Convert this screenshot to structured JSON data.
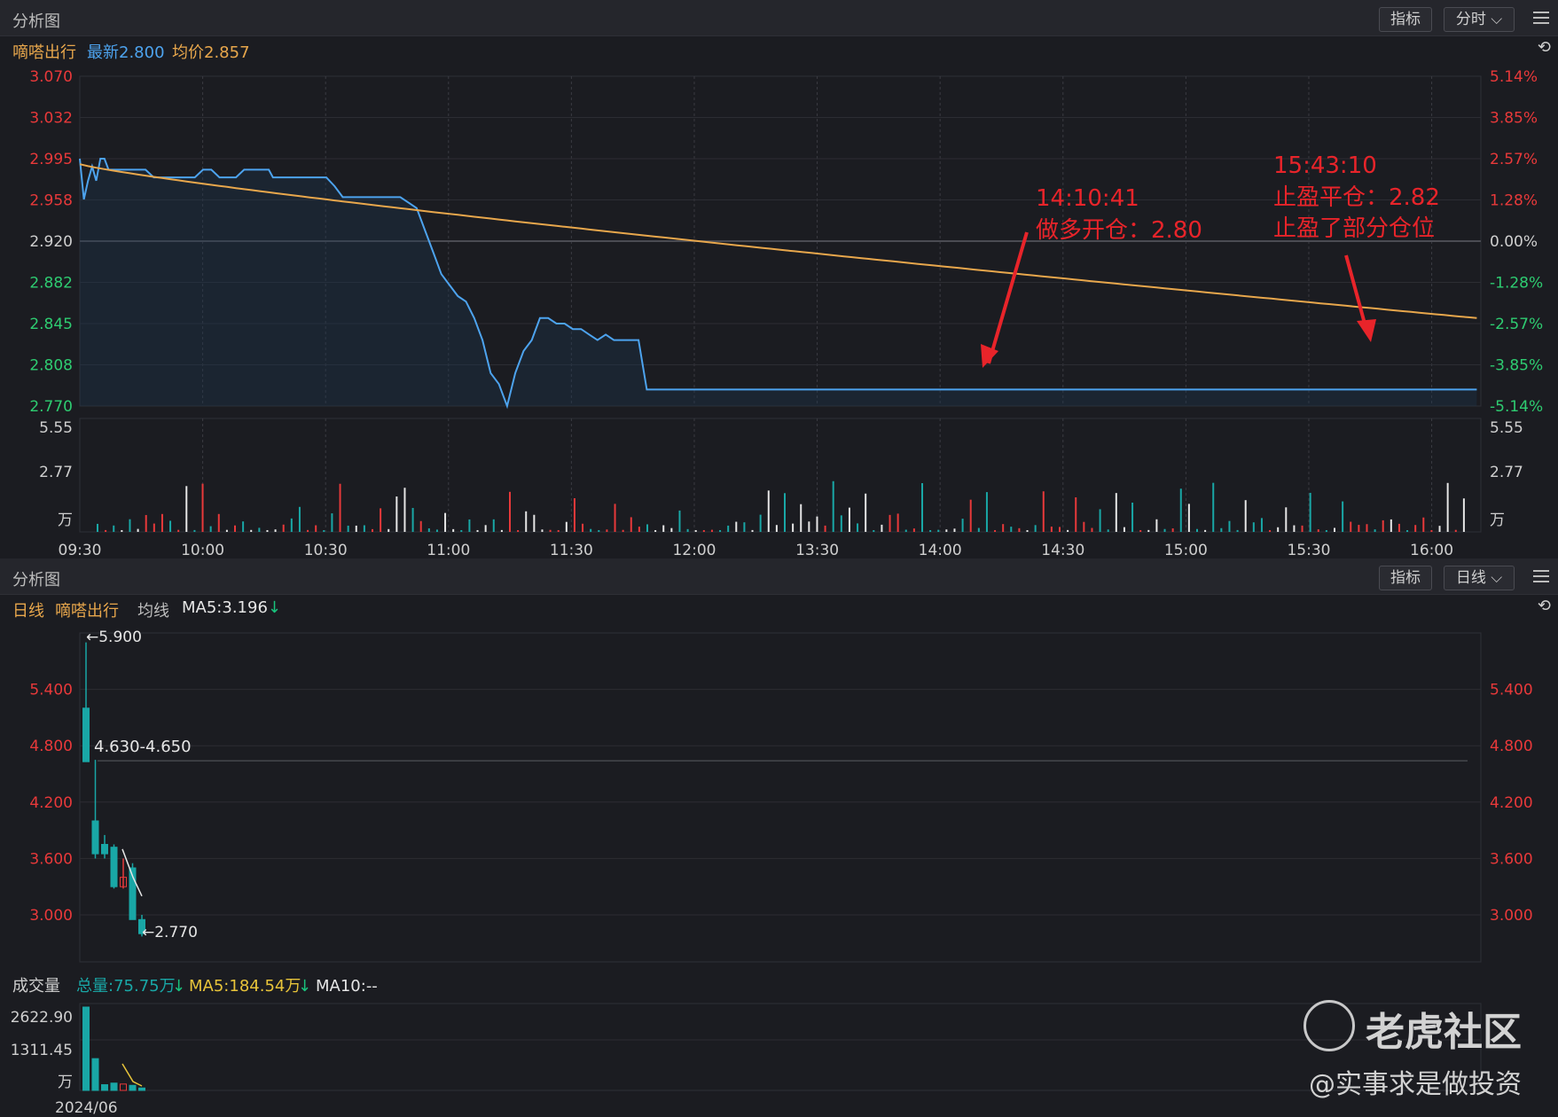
{
  "top_panel": {
    "title": "分析图",
    "btn_indicator": "指标",
    "btn_period": "分时 ⌵",
    "stock_name": "嘀嗒出行",
    "latest": "最新2.800",
    "avg": "均价2.857"
  },
  "bottom_panel": {
    "title": "分析图",
    "btn_indicator": "指标",
    "btn_period": "日线 ⌵",
    "period_label": "日线",
    "stock_name": "嘀嗒出行",
    "ma_label": "均线",
    "ma5": "MA5:3.196",
    "vol_title": "成交量",
    "vol_total": "总量:75.75万",
    "vol_ma5": "MA5:184.54万",
    "vol_ma10": "MA10:--",
    "date_label": "2024/06"
  },
  "colors": {
    "price": "#4da3ee",
    "avg": "#e8a74c",
    "up": "#e8393a",
    "down": "#19a7a6",
    "neutral": "#e6e6e6",
    "annot": "#e8242a"
  },
  "chart_data": [
    {
      "type": "line",
      "title": "",
      "y_ticks_left": [
        "3.070",
        "3.032",
        "2.995",
        "2.958",
        "2.920",
        "2.882",
        "2.845",
        "2.808",
        "2.770"
      ],
      "y_ticks_right": [
        "5.14%",
        "3.85%",
        "2.57%",
        "1.28%",
        "0.00%",
        "-1.28%",
        "-2.57%",
        "-3.85%",
        "-5.14%"
      ],
      "ylim": [
        2.77,
        3.07
      ],
      "x_ticks": [
        "09:30",
        "10:00",
        "10:30",
        "11:00",
        "11:30",
        "12:00",
        "13:30",
        "14:00",
        "14:30",
        "15:00",
        "15:30",
        "16:00"
      ],
      "series": [
        {
          "x": [
            0,
            1,
            2,
            3,
            4,
            5,
            6,
            7,
            8,
            9,
            10,
            12,
            14,
            16,
            18,
            20,
            22,
            24,
            26,
            28,
            30,
            32,
            34,
            36,
            38,
            40,
            42,
            44,
            46,
            47,
            48,
            49,
            50,
            51,
            52,
            53,
            54,
            55,
            56,
            58,
            60,
            62,
            64,
            66,
            68,
            70,
            72,
            74,
            76,
            78,
            80,
            82,
            84,
            86,
            88,
            90,
            92,
            94,
            96,
            98,
            100,
            102,
            104,
            106,
            108,
            110,
            112,
            114,
            116,
            118,
            120,
            122,
            124,
            126,
            128,
            130,
            132,
            134,
            136,
            138,
            140,
            142,
            144,
            146,
            148,
            150,
            152,
            154,
            156,
            158,
            160,
            162,
            164,
            166,
            168,
            170,
            172,
            174,
            176,
            178,
            180,
            182,
            184,
            186,
            188,
            190,
            192,
            194,
            196,
            198,
            200,
            202,
            204,
            206,
            208,
            210,
            212,
            214,
            216,
            218,
            220,
            222,
            224,
            226,
            228,
            230,
            232,
            234,
            236,
            238,
            240,
            242,
            244,
            246,
            248,
            250,
            252,
            254,
            256,
            258,
            260,
            262,
            264,
            266,
            268,
            270,
            272,
            274,
            276,
            278,
            280,
            282,
            284,
            286,
            288,
            290,
            292,
            294,
            296,
            298,
            300,
            302,
            304,
            306,
            308,
            310,
            312,
            314,
            316,
            318,
            320,
            322,
            324,
            326,
            328,
            330,
            332,
            334,
            336,
            338,
            340
          ],
          "values": [
            2.995,
            2.958,
            2.975,
            2.988,
            2.975,
            2.995,
            2.995,
            2.985,
            2.985,
            2.985,
            2.985,
            2.985,
            2.985,
            2.985,
            2.978,
            2.978,
            2.978,
            2.978,
            2.978,
            2.978,
            2.985,
            2.985,
            2.978,
            2.978,
            2.978,
            2.985,
            2.985,
            2.985,
            2.985,
            2.978,
            2.978,
            2.978,
            2.978,
            2.978,
            2.978,
            2.978,
            2.978,
            2.978,
            2.978,
            2.978,
            2.978,
            2.97,
            2.96,
            2.96,
            2.96,
            2.96,
            2.96,
            2.96,
            2.96,
            2.96,
            2.955,
            2.95,
            2.93,
            2.91,
            2.89,
            2.88,
            2.87,
            2.865,
            2.85,
            2.83,
            2.8,
            2.79,
            2.77,
            2.8,
            2.82,
            2.83,
            2.85,
            2.85,
            2.845,
            2.845,
            2.84,
            2.84,
            2.835,
            2.83,
            2.835,
            2.83,
            2.83,
            2.83,
            2.83,
            2.785,
            2.785,
            2.785,
            2.785,
            2.785,
            2.785,
            2.785,
            2.785,
            2.785,
            2.785,
            2.785,
            2.785,
            2.785,
            2.785,
            2.785,
            2.785,
            2.785,
            2.785,
            2.785,
            2.785,
            2.785,
            2.785,
            2.785,
            2.785,
            2.785,
            2.785,
            2.785,
            2.785,
            2.785,
            2.785,
            2.785,
            2.785,
            2.785,
            2.785,
            2.785,
            2.785,
            2.785,
            2.785,
            2.785,
            2.785,
            2.785,
            2.785,
            2.785,
            2.785,
            2.785,
            2.785,
            2.785,
            2.785,
            2.785,
            2.785,
            2.785,
            2.785,
            2.785,
            2.785,
            2.785,
            2.785,
            2.785,
            2.785,
            2.785,
            2.785,
            2.785,
            2.785,
            2.785,
            2.785,
            2.785,
            2.785,
            2.785,
            2.785,
            2.785,
            2.785,
            2.785,
            2.785,
            2.785,
            2.785,
            2.785,
            2.785,
            2.785,
            2.785,
            2.785,
            2.785,
            2.785,
            2.785,
            2.785,
            2.785,
            2.785,
            2.785,
            2.785,
            2.785,
            2.785,
            2.785,
            2.785,
            2.785,
            2.785,
            2.785,
            2.785,
            2.785,
            2.785,
            2.785,
            2.785,
            2.785,
            2.785,
            2.785
          ]
        },
        {
          "x": [
            0
          ],
          "values": [
            2.85
          ]
        }
      ],
      "annotations": [
        {
          "time": "14:10:41",
          "text": "做多开仓：2.80"
        },
        {
          "time": "15:43:10",
          "text": "止盈平仓：2.82",
          "text2": "止盈了部分仓位"
        }
      ],
      "volume_ticks": [
        "5.55",
        "2.77",
        "万"
      ]
    },
    {
      "type": "candlestick",
      "y_ticks": [
        "5.400",
        "4.800",
        "4.200",
        "3.600",
        "3.000"
      ],
      "ylim": [
        2.5,
        6.0
      ],
      "candles": [
        {
          "open": 5.2,
          "close": 4.63,
          "high": 5.9,
          "low": 4.63,
          "color": "down"
        },
        {
          "open": 4.0,
          "close": 3.65,
          "high": 4.65,
          "low": 3.6,
          "color": "down"
        },
        {
          "open": 3.75,
          "close": 3.65,
          "high": 3.85,
          "low": 3.6,
          "color": "down"
        },
        {
          "open": 3.72,
          "close": 3.3,
          "high": 3.75,
          "low": 3.28,
          "color": "down"
        },
        {
          "open": 3.3,
          "close": 3.4,
          "high": 3.6,
          "low": 3.28,
          "color": "up"
        },
        {
          "open": 3.5,
          "close": 2.95,
          "high": 3.55,
          "low": 2.95,
          "color": "down"
        },
        {
          "open": 2.95,
          "close": 2.8,
          "high": 3.0,
          "low": 2.77,
          "color": "down"
        }
      ],
      "labels": {
        "high": "←5.900",
        "gap": "4.630-4.650",
        "low": "←2.770"
      },
      "volume_ticks": [
        "2622.90",
        "1311.45",
        "万"
      ],
      "volumes": [
        2622.9,
        1000,
        180,
        230,
        200,
        160,
        75.75
      ]
    }
  ],
  "watermark": {
    "brand": "老虎社区",
    "handle": "@实事求是做投资"
  }
}
